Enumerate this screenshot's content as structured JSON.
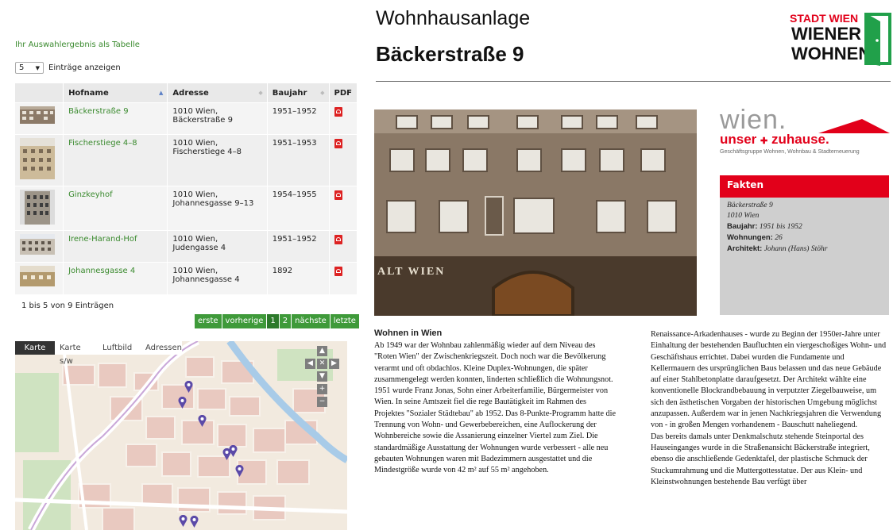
{
  "table_link": "Ihr Auswahlergebnis als Tabelle",
  "length": {
    "value": "5",
    "label": "Einträge anzeigen"
  },
  "columns": [
    "Hofname",
    "Adresse",
    "Baujahr",
    "PDF"
  ],
  "rows": [
    {
      "name": "Bäckerstraße 9",
      "address": "1010 Wien, Bäckerstraße 9",
      "year": "1951–1952"
    },
    {
      "name": "Fischerstiege 4–8",
      "address": "1010 Wien, Fischerstiege 4–8",
      "year": "1951–1953"
    },
    {
      "name": "Ginzkeyhof",
      "address": "1010 Wien, Johannesgasse 9–13",
      "year": "1954–1955"
    },
    {
      "name": "Irene-Harand-Hof",
      "address": "1010 Wien, Judengasse 4",
      "year": "1951–1952"
    },
    {
      "name": "Johannesgasse 4",
      "address": "1010 Wien, Johannesgasse 4",
      "year": "1892"
    }
  ],
  "info": "1 bis 5 von 9 Einträgen",
  "pager": [
    "erste",
    "vorherige",
    "1",
    "2",
    "nächste",
    "letzte"
  ],
  "map_tabs": [
    "Karte",
    "Karte s/w",
    "Luftbild",
    "Adressen"
  ],
  "title1": "Wohnhausanlage",
  "title2": "Bäckerstraße 9",
  "logo": {
    "l1": "STADT WIEN",
    "l2": "WIENER",
    "l3": "WOHNEN"
  },
  "wien_logo": {
    "l1": "wien.",
    "l2": "unser",
    "l3": "zuhause.",
    "sub": "Geschäftsgruppe Wohnen, Wohnbau & Stadterneuerung"
  },
  "photo_sign": "ALT WIEN",
  "facts": {
    "heading": "Fakten",
    "line1": "Bäckerstraße 9",
    "line2": "1010 Wien",
    "baujahr_label": "Baujahr:",
    "baujahr": "1951 bis 1952",
    "wohnungen_label": "Wohnungen:",
    "wohnungen": "26",
    "architekt_label": "Architekt:",
    "architekt": "Johann (Hans) Stöhr"
  },
  "section_heading": "Wohnen in Wien",
  "col1": "Ab 1949 war der Wohnbau zahlenmäßig wieder auf dem Niveau des \"Roten Wien\" der Zwischenkriegszeit. Doch noch war die Bevölkerung verarmt und oft obdachlos. Kleine Duplex-Wohnungen, die später zusammengelegt werden konnten, linderten schließlich die Wohnungsnot. 1951 wurde Franz Jonas, Sohn einer Arbeiterfamilie, Bürgermeister von Wien. In seine Amtszeit fiel die rege Bautätigkeit im Rahmen des Projektes \"Sozialer Städtebau\" ab 1952. Das 8-Punkte-Programm hatte die Trennung von Wohn- und Gewerbebereichen, eine Auflockerung der Wohnbereiche sowie die Assanierung einzelner Viertel zum Ziel. Die standardmäßige Ausstattung der Wohnungen wurde verbessert - alle neu gebauten Wohnungen waren mit Badezimmern ausgestattet und die Mindestgröße wurde von 42 m² auf 55 m² angehoben.",
  "col2a": "Renaissance-Arkadenhauses - wurde zu Beginn der 1950er-Jahre unter Einhaltung der bestehenden Baufluchten ein viergeschoßiges Wohn- und Geschäftshaus errichtet. Dabei wurden die Fundamente und Kellermauern des ursprünglichen Baus belassen und das neue Gebäude auf einer Stahlbetonplatte daraufgesetzt. Der Architekt wählte eine konventionelle Blockrandbebauung in verputzter Ziegelbauweise, um sich den ästhetischen Vorgaben der historischen Umgebung möglichst anzupassen. Außerdem war in jenen Nachkriegsjahren die Verwendung von - in großen Mengen vorhandenem - Bauschutt naheliegend.",
  "col2b": "Das bereits damals unter Denkmalschutz stehende Steinportal des Hauseinganges wurde in die Straßenansicht Bäckerstraße integriert, ebenso die anschließende Gedenktafel, der plastische Schmuck der Stuckumrahmung und die Muttergottesstatue. Der aus Klein- und Kleinstwohnungen bestehende Bau verfügt über"
}
